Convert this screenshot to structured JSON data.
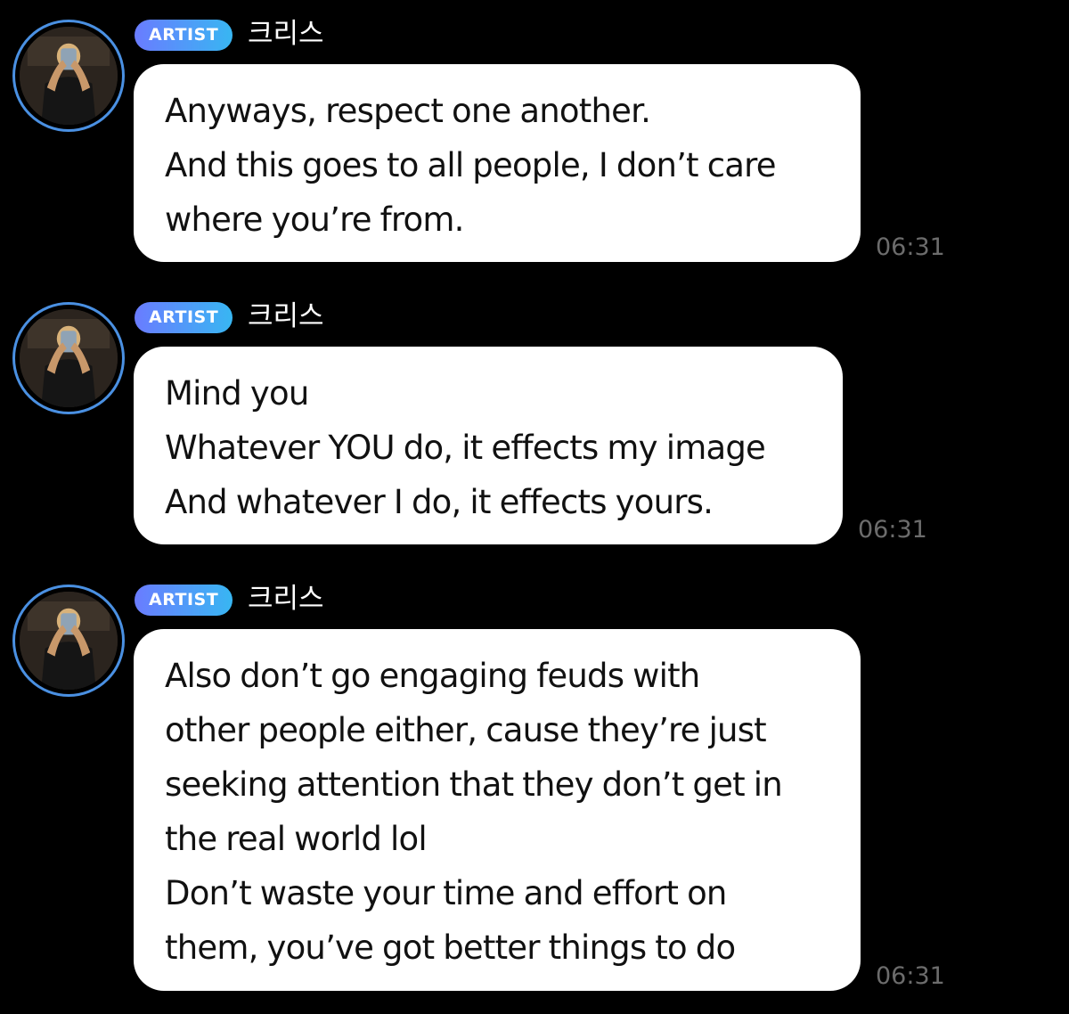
{
  "messages": [
    {
      "badge": "ARTIST",
      "sender": "크리스",
      "lines": [
        "Anyways, respect one another.",
        "And this goes to all people, I don’t care",
        "where you’re from."
      ],
      "time": "06:31"
    },
    {
      "badge": "ARTIST",
      "sender": "크리스",
      "lines": [
        "Mind you",
        "Whatever YOU do, it effects my image",
        "And whatever I do, it effects yours."
      ],
      "time": "06:31"
    },
    {
      "badge": "ARTIST",
      "sender": "크리스",
      "lines": [
        "Also don’t go engaging feuds with",
        "other people either, cause they’re just",
        "seeking attention that they don’t get in",
        "the real world lol",
        "Don’t waste your time and effort on",
        "them, you’ve got better things to do"
      ],
      "time": "06:31"
    }
  ],
  "colors": {
    "background": "#000000",
    "bubble": "#ffffff",
    "badge_gradient_start": "#6a7cff",
    "badge_gradient_end": "#38b6f2",
    "avatar_ring": "#4a90e2",
    "timestamp": "#6c6c6c"
  },
  "icons": {
    "avatar": "profile-photo"
  }
}
